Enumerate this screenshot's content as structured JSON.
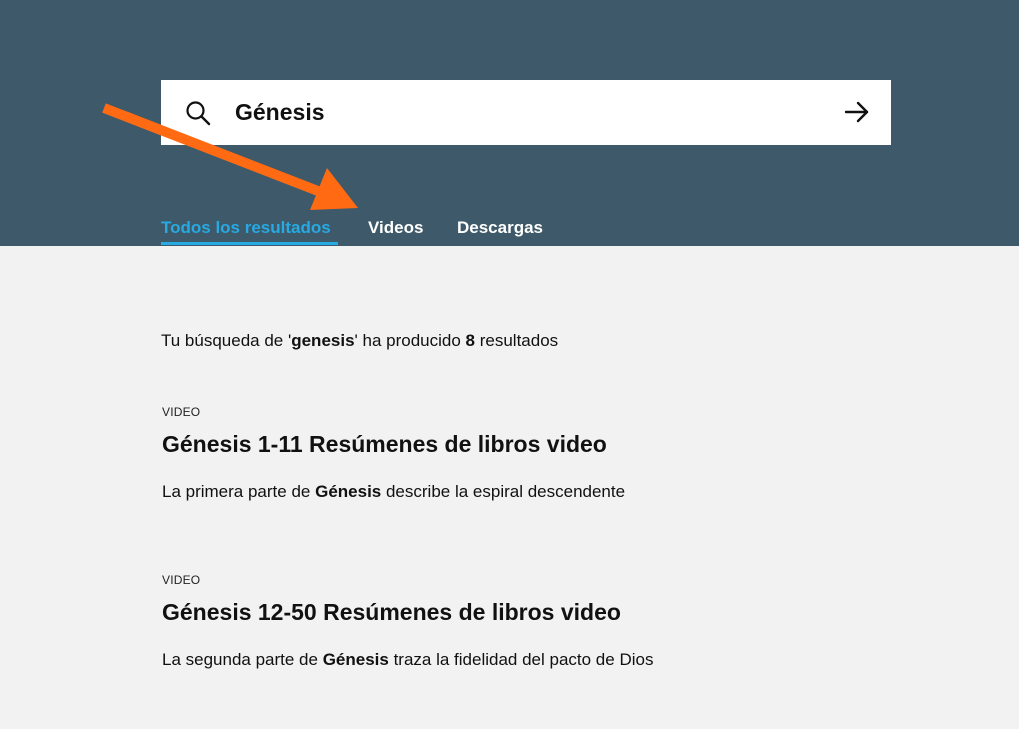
{
  "search": {
    "value": "Génesis",
    "submit_icon": "arrow-right-icon",
    "search_icon": "search-icon"
  },
  "tabs": [
    {
      "label": "Todos los resultados",
      "active": true
    },
    {
      "label": "Videos",
      "active": false
    },
    {
      "label": "Descargas",
      "active": false
    }
  ],
  "summary": {
    "prefix": "Tu búsqueda de '",
    "query": "genesis",
    "middle": "' ha producido ",
    "count": "8",
    "suffix": " resultados"
  },
  "results": [
    {
      "type": "VIDEO",
      "title": "Génesis 1-11 Resúmenes de libros video",
      "desc_before": "La primera parte de ",
      "desc_bold": "Génesis",
      "desc_after": " describe la espiral descendente"
    },
    {
      "type": "VIDEO",
      "title": "Génesis 12-50 Resúmenes de libros video",
      "desc_before": "La segunda parte de ",
      "desc_bold": "Génesis",
      "desc_after": " traza la fidelidad del pacto de Dios"
    }
  ],
  "colors": {
    "header_bg": "#3e5a6a",
    "page_bg": "#f2f2f2",
    "active_tab": "#27a9e1",
    "annotation_arrow": "#ff6a13"
  }
}
